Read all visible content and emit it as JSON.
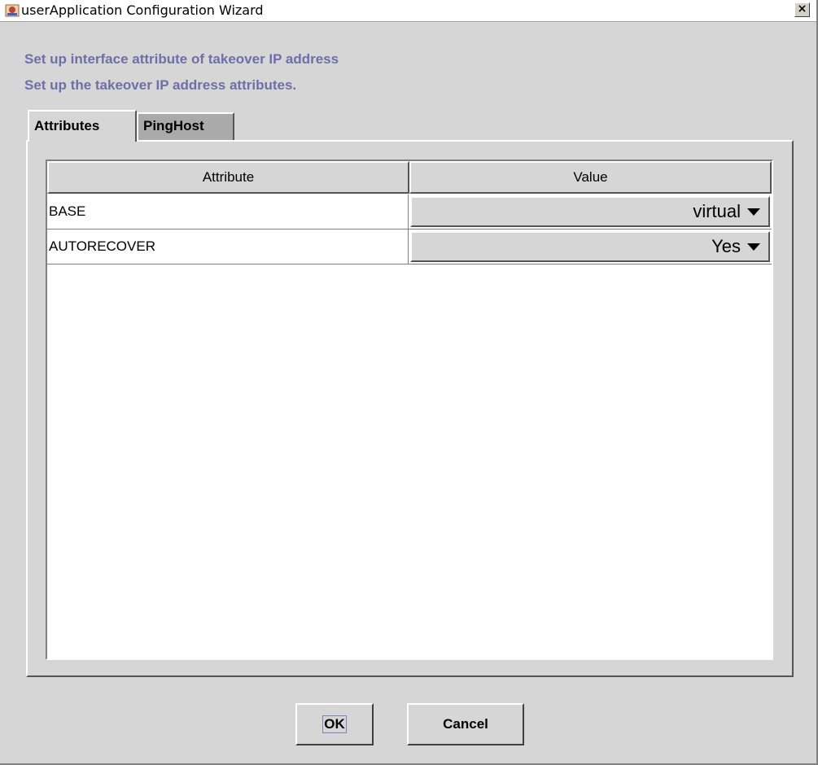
{
  "window": {
    "title": "userApplication Configuration Wizard",
    "close_label": "×"
  },
  "headings": {
    "line1": "Set up interface attribute of takeover IP address",
    "line2": "Set up the takeover IP address attributes."
  },
  "tabs": [
    {
      "label": "Attributes",
      "selected": true
    },
    {
      "label": "PingHost",
      "selected": false
    }
  ],
  "table": {
    "columns": [
      "Attribute",
      "Value"
    ],
    "rows": [
      {
        "attribute": "BASE",
        "value": "virtual"
      },
      {
        "attribute": "AUTORECOVER",
        "value": "Yes"
      }
    ]
  },
  "buttons": {
    "ok": "OK",
    "cancel": "Cancel"
  },
  "colors": {
    "heading": "#6f6fa8",
    "background": "#d6d6d6"
  }
}
